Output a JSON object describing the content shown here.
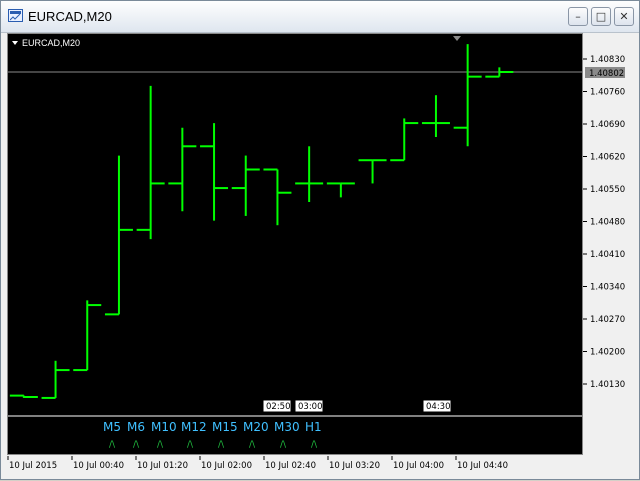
{
  "window": {
    "title": "EURCAD,M20"
  },
  "chart": {
    "symbol_label": "EURCAD,M20",
    "current_price": "1.40802",
    "bar_color": "#00ff00",
    "price_axis_labels": [
      "1.40830",
      "1.40760",
      "1.40690",
      "1.40620",
      "1.40550",
      "1.40480",
      "1.40410",
      "1.40340",
      "1.40270",
      "1.40200",
      "1.40130"
    ],
    "time_axis_labels": [
      "10 Jul 2015",
      "10 Jul 00:40",
      "10 Jul 01:20",
      "10 Jul 02:00",
      "10 Jul 02:40",
      "10 Jul 03:20",
      "10 Jul 04:00",
      "10 Jul 04:40"
    ],
    "time_markers": [
      "02:50",
      "03:00",
      "04:30"
    ],
    "timeframes": [
      {
        "label": "M5",
        "arrow": "/\\"
      },
      {
        "label": "M6",
        "arrow": "/\\"
      },
      {
        "label": "M10",
        "arrow": "/\\"
      },
      {
        "label": "M12",
        "arrow": "/\\"
      },
      {
        "label": "M15",
        "arrow": "/\\"
      },
      {
        "label": "M20",
        "arrow": "/\\"
      },
      {
        "label": "M30",
        "arrow": "/\\"
      },
      {
        "label": "H1",
        "arrow": "/\\"
      }
    ]
  },
  "chart_data": {
    "type": "ohlc",
    "ylim": [
      1.401,
      1.4088
    ],
    "bars": [
      {
        "o": 1.40105,
        "h": 1.40105,
        "l": 1.401,
        "c": 1.40102
      },
      {
        "o": 1.401,
        "h": 1.4018,
        "l": 1.401,
        "c": 1.4016
      },
      {
        "o": 1.4016,
        "h": 1.4031,
        "l": 1.4016,
        "c": 1.403
      },
      {
        "o": 1.4028,
        "h": 1.40622,
        "l": 1.4028,
        "c": 1.40462
      },
      {
        "o": 1.40462,
        "h": 1.40772,
        "l": 1.40442,
        "c": 1.40562
      },
      {
        "o": 1.40562,
        "h": 1.40682,
        "l": 1.40502,
        "c": 1.40642
      },
      {
        "o": 1.40642,
        "h": 1.40692,
        "l": 1.40482,
        "c": 1.40552
      },
      {
        "o": 1.40552,
        "h": 1.40622,
        "l": 1.40492,
        "c": 1.40592
      },
      {
        "o": 1.40592,
        "h": 1.40592,
        "l": 1.40472,
        "c": 1.40542
      },
      {
        "o": 1.40562,
        "h": 1.40642,
        "l": 1.40522,
        "c": 1.40562
      },
      {
        "o": 1.40562,
        "h": 1.40562,
        "l": 1.40532,
        "c": 1.40562
      },
      {
        "o": 1.40612,
        "h": 1.40612,
        "l": 1.40562,
        "c": 1.40612
      },
      {
        "o": 1.40612,
        "h": 1.40702,
        "l": 1.40612,
        "c": 1.40692
      },
      {
        "o": 1.40692,
        "h": 1.40752,
        "l": 1.40662,
        "c": 1.40692
      },
      {
        "o": 1.40682,
        "h": 1.40862,
        "l": 1.40642,
        "c": 1.40792
      },
      {
        "o": 1.40792,
        "h": 1.40812,
        "l": 1.40792,
        "c": 1.40802
      }
    ]
  }
}
